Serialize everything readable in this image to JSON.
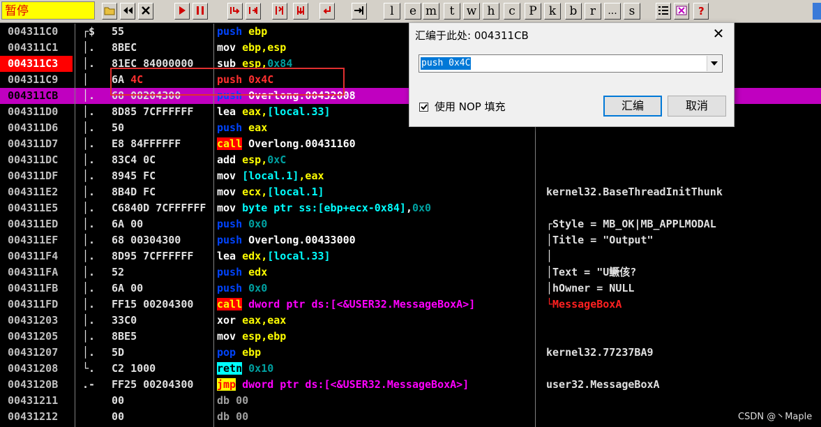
{
  "toolbar": {
    "status": "暂停",
    "letter_buttons": [
      "l",
      "e",
      "m",
      "t",
      "w",
      "h",
      "c",
      "P",
      "k",
      "b",
      "r",
      "...",
      "s"
    ]
  },
  "rows": [
    {
      "addr": "004311C0",
      "brk": "┌$",
      "hex": "55",
      "mn": "push",
      "mclass": "m-push",
      "ops": [
        {
          "t": " ebp",
          "c": "reg"
        }
      ],
      "cmt": ""
    },
    {
      "addr": "004311C1",
      "brk": "│.",
      "hex": "8BEC",
      "mn": "mov",
      "mclass": "",
      "ops": [
        {
          "t": " ebp,esp",
          "c": "reg"
        }
      ],
      "cmt": ""
    },
    {
      "addr": "004311C3",
      "brk": "│.",
      "hex": "81EC 84000000",
      "mn": "sub",
      "mclass": "",
      "ops": [
        {
          "t": " esp,",
          "c": "reg"
        },
        {
          "t": "0x84",
          "c": "imm"
        }
      ],
      "cmt": "",
      "bp": true
    },
    {
      "addr": "004311C9",
      "brk": "│",
      "hex": "6A 4C",
      "mn": "push",
      "mclass": "m-push",
      "ops": [
        {
          "t": " 0x4C",
          "c": "imm"
        }
      ],
      "cmt": ""
    },
    {
      "addr": "004311CB",
      "brk": "│.",
      "hex": "68 08204300",
      "mn": "push",
      "mclass": "m-push",
      "ops": [
        {
          "t": " Overlong.00432008",
          "c": "sym"
        }
      ],
      "cmt": "",
      "hl": true
    },
    {
      "addr": "004311D0",
      "brk": "│.",
      "hex": "8D85 7CFFFFFF",
      "mn": "lea",
      "mclass": "",
      "ops": [
        {
          "t": " eax,",
          "c": "reg"
        },
        {
          "t": "[local.33]",
          "c": "mem"
        }
      ],
      "cmt": ""
    },
    {
      "addr": "004311D6",
      "brk": "│.",
      "hex": "50",
      "mn": "push",
      "mclass": "m-push",
      "ops": [
        {
          "t": " eax",
          "c": "reg"
        }
      ],
      "cmt": ""
    },
    {
      "addr": "004311D7",
      "brk": "│.",
      "hex": "E8 84FFFFFF",
      "mn": "call",
      "mclass": "m-call",
      "ops": [
        {
          "t": " Overlong.00431160",
          "c": "sym"
        }
      ],
      "cmt": ""
    },
    {
      "addr": "004311DC",
      "brk": "│.",
      "hex": "83C4 0C",
      "mn": "add",
      "mclass": "",
      "ops": [
        {
          "t": " esp,",
          "c": "reg"
        },
        {
          "t": "0xC",
          "c": "imm"
        }
      ],
      "cmt": ""
    },
    {
      "addr": "004311DF",
      "brk": "│.",
      "hex": "8945 FC",
      "mn": "mov",
      "mclass": "",
      "ops": [
        {
          "t": " [local.1]",
          "c": "mem"
        },
        {
          "t": ",eax",
          "c": "reg"
        }
      ],
      "cmt": ""
    },
    {
      "addr": "004311E2",
      "brk": "│.",
      "hex": "8B4D FC",
      "mn": "mov",
      "mclass": "",
      "ops": [
        {
          "t": " ecx,",
          "c": "reg"
        },
        {
          "t": "[local.1]",
          "c": "mem"
        }
      ],
      "cmt": "kernel32.BaseThreadInitThunk"
    },
    {
      "addr": "004311E5",
      "brk": "│.",
      "hex": "C6840D 7CFFFFFF",
      "mn": "mov",
      "mclass": "",
      "ops": [
        {
          "t": " byte ptr ss:[ebp+ecx-0x84]",
          "c": "mem"
        },
        {
          "t": ",",
          "c": "sym"
        },
        {
          "t": "0x0",
          "c": "imm"
        }
      ],
      "cmt": ""
    },
    {
      "addr": "004311ED",
      "brk": "│.",
      "hex": "6A 00",
      "mn": "push",
      "mclass": "m-push",
      "ops": [
        {
          "t": " 0x0",
          "c": "imm"
        }
      ],
      "cmt": "┌Style = MB_OK|MB_APPLMODAL"
    },
    {
      "addr": "004311EF",
      "brk": "│.",
      "hex": "68 00304300",
      "mn": "push",
      "mclass": "m-push",
      "ops": [
        {
          "t": " Overlong.00433000",
          "c": "sym"
        }
      ],
      "cmt": "│Title = \"Output\""
    },
    {
      "addr": "004311F4",
      "brk": "│.",
      "hex": "8D95 7CFFFFFF",
      "mn": "lea",
      "mclass": "",
      "ops": [
        {
          "t": " edx,",
          "c": "reg"
        },
        {
          "t": "[local.33]",
          "c": "mem"
        }
      ],
      "cmt": "│"
    },
    {
      "addr": "004311FA",
      "brk": "│.",
      "hex": "52",
      "mn": "push",
      "mclass": "m-push",
      "ops": [
        {
          "t": " edx",
          "c": "reg"
        }
      ],
      "cmt": "│Text = \"U鳜侅?"
    },
    {
      "addr": "004311FB",
      "brk": "│.",
      "hex": "6A 00",
      "mn": "push",
      "mclass": "m-push",
      "ops": [
        {
          "t": " 0x0",
          "c": "imm"
        }
      ],
      "cmt": "│hOwner = NULL"
    },
    {
      "addr": "004311FD",
      "brk": "│.",
      "hex": "FF15 00204300",
      "mn": "call",
      "mclass": "m-call",
      "ops": [
        {
          "t": " dword ptr ds:[<&USER32.MessageBoxA>]",
          "c": "api"
        }
      ],
      "cmt": "└MessageBoxA",
      "cmtRed": true
    },
    {
      "addr": "00431203",
      "brk": "│.",
      "hex": "33C0",
      "mn": "xor",
      "mclass": "",
      "ops": [
        {
          "t": " eax,eax",
          "c": "reg"
        }
      ],
      "cmt": ""
    },
    {
      "addr": "00431205",
      "brk": "│.",
      "hex": "8BE5",
      "mn": "mov",
      "mclass": "",
      "ops": [
        {
          "t": " esp,ebp",
          "c": "reg"
        }
      ],
      "cmt": ""
    },
    {
      "addr": "00431207",
      "brk": "│.",
      "hex": "5D",
      "mn": "pop",
      "mclass": "m-pop",
      "ops": [
        {
          "t": " ebp",
          "c": "reg"
        }
      ],
      "cmt": "kernel32.77237BA9"
    },
    {
      "addr": "00431208",
      "brk": "└.",
      "hex": "C2 1000",
      "mn": "retn",
      "mclass": "m-retn",
      "ops": [
        {
          "t": " 0x10",
          "c": "imm"
        }
      ],
      "cmt": ""
    },
    {
      "addr": "0043120B",
      "brk": " .-",
      "hex": "FF25 00204300",
      "mn": "jmp",
      "mclass": "m-jmp",
      "ops": [
        {
          "t": " dword ptr ds:[<&USER32.MessageBoxA>]",
          "c": "api"
        }
      ],
      "cmt": "user32.MessageBoxA"
    },
    {
      "addr": "00431211",
      "brk": "",
      "hex": "00",
      "mn": "db",
      "mclass": "db",
      "ops": [
        {
          "t": " 00",
          "c": "db"
        }
      ],
      "cmt": ""
    },
    {
      "addr": "00431212",
      "brk": "",
      "hex": "00",
      "mn": "db",
      "mclass": "db",
      "ops": [
        {
          "t": " 00",
          "c": "db"
        }
      ],
      "cmt": ""
    }
  ],
  "dialog": {
    "title": "汇编于此处: 004311CB",
    "input_value": "push 0x4C",
    "checkbox_label": "使用 NOP 填充",
    "checkbox_checked": true,
    "assemble_label": "汇编",
    "cancel_label": "取消"
  },
  "watermark": "CSDN @丶Maple"
}
